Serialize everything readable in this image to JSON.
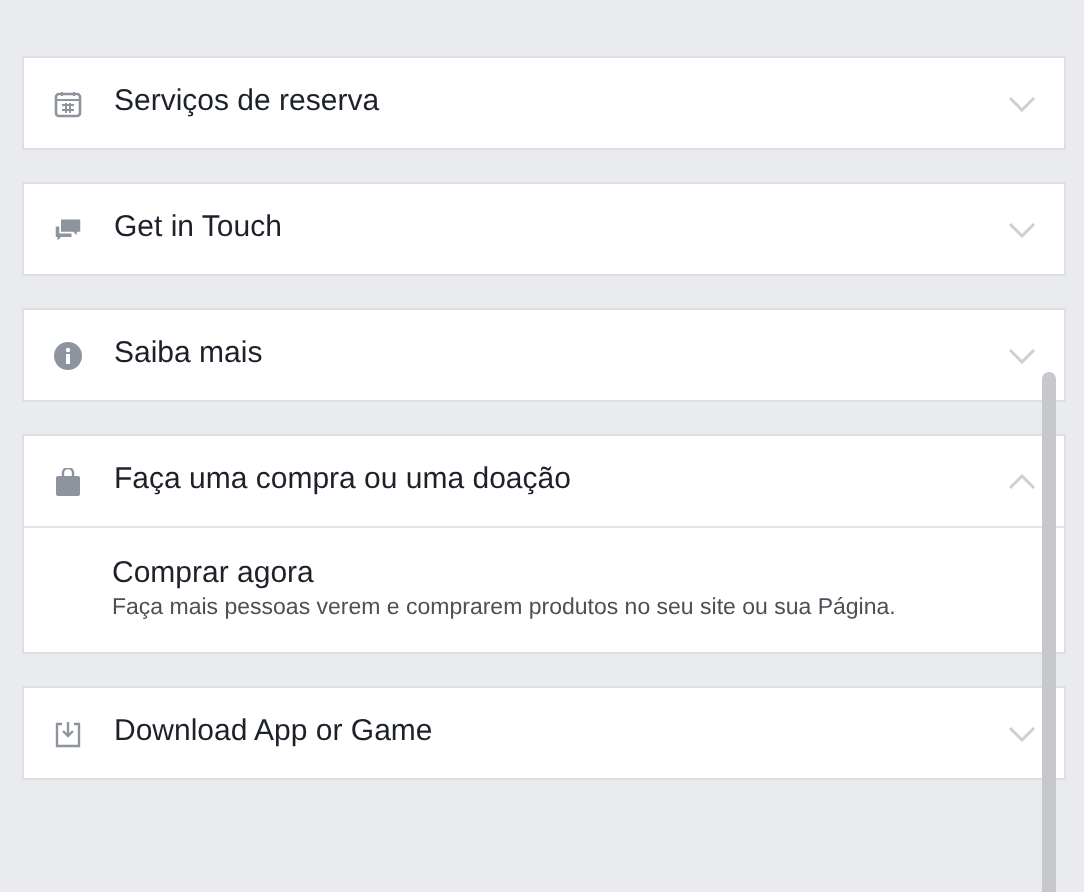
{
  "sections": [
    {
      "kind": "calendar",
      "title": "Serviços de reserva",
      "expanded": false
    },
    {
      "kind": "chat",
      "title": "Get in Touch",
      "expanded": false
    },
    {
      "kind": "info",
      "title": "Saiba mais",
      "expanded": false
    },
    {
      "kind": "bag",
      "title": "Faça uma compra ou uma doação",
      "expanded": true,
      "options": [
        {
          "title": "Comprar agora",
          "description": "Faça mais pessoas verem e comprarem produtos no seu site ou sua Página."
        }
      ]
    },
    {
      "kind": "download",
      "title": "Download App or Game",
      "expanded": false
    }
  ]
}
